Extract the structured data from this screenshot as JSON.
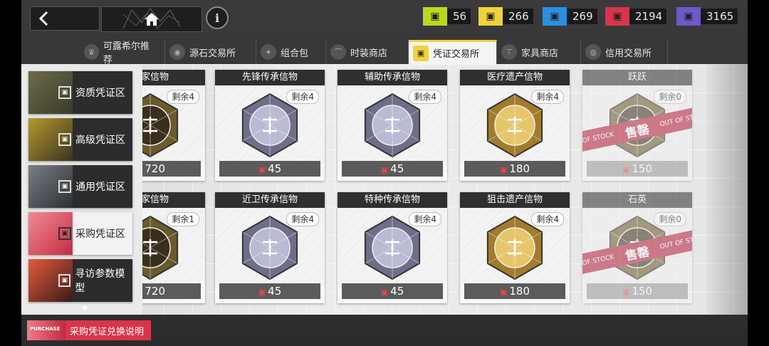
{
  "top": {
    "resources": [
      {
        "name": "green-token",
        "value": "56",
        "color": "#b8d91f"
      },
      {
        "name": "yellow-token",
        "value": "266",
        "color": "#f1d23a"
      },
      {
        "name": "blue-token",
        "value": "269",
        "color": "#2a8fe0"
      },
      {
        "name": "red-token",
        "value": "2194",
        "color": "#d8354b"
      },
      {
        "name": "purple-token",
        "value": "3165",
        "color": "#6f58c9"
      }
    ]
  },
  "tabs": [
    {
      "label": "可露希尔推荐",
      "active": false
    },
    {
      "label": "源石交易所",
      "active": false
    },
    {
      "label": "组合包",
      "active": false
    },
    {
      "label": "时装商店",
      "active": false
    },
    {
      "label": "凭证交易所",
      "active": true
    },
    {
      "label": "家具商店",
      "active": false
    },
    {
      "label": "信用交易所",
      "active": false
    }
  ],
  "categories": [
    {
      "label": "资质凭证区",
      "active": false
    },
    {
      "label": "高级凭证区",
      "active": false
    },
    {
      "label": "通用凭证区",
      "active": false
    },
    {
      "label": "采购凭证区",
      "active": true
    },
    {
      "label": "寻访参数模型",
      "active": false
    }
  ],
  "cards": [
    {
      "title": "皇家信物",
      "stock": "剩余4",
      "price": "720",
      "gem": "dark"
    },
    {
      "title": "先锋传承信物",
      "stock": "剩余4",
      "price": "45",
      "gem": "silver"
    },
    {
      "title": "辅助传承信物",
      "stock": "剩余4",
      "price": "45",
      "gem": "silver"
    },
    {
      "title": "医疗遗产信物",
      "stock": "剩余4",
      "price": "180",
      "gem": "gold"
    },
    {
      "title": "跃跃",
      "stock": "剩余0",
      "price": "150",
      "gem": "dark",
      "soldout": true
    },
    {
      "title": "皇家信物",
      "stock": "剩余1",
      "price": "720",
      "gem": "dark"
    },
    {
      "title": "近卫传承信物",
      "stock": "剩余4",
      "price": "45",
      "gem": "silver"
    },
    {
      "title": "特种传承信物",
      "stock": "剩余4",
      "price": "45",
      "gem": "silver"
    },
    {
      "title": "狙击遗产信物",
      "stock": "剩余4",
      "price": "180",
      "gem": "gold"
    },
    {
      "title": "石英",
      "stock": "剩余0",
      "price": "150",
      "gem": "dark",
      "soldout": true
    }
  ],
  "soldout_band": {
    "left": "OF STOCK",
    "center": "售罄",
    "right": "OUT OF ST"
  },
  "bottom": {
    "button_label": "采购凭证兑换说明",
    "thumb_text": "PURCHASE"
  },
  "icons": {
    "back": "back-arrow-icon",
    "home": "home-icon",
    "info": "info-icon"
  }
}
